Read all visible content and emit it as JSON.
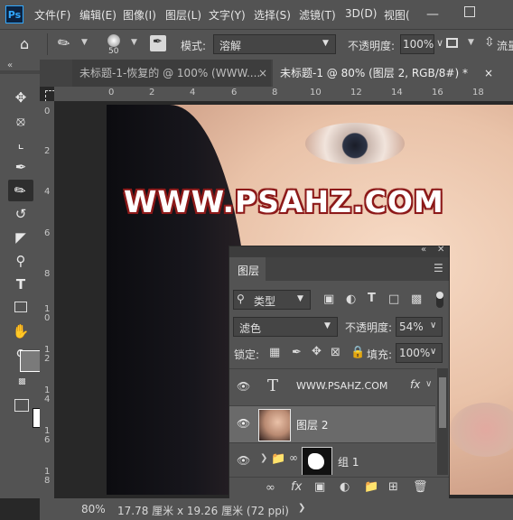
{
  "app": {
    "logo_text": "Ps"
  },
  "menubar": {
    "items": [
      "文件(F)",
      "编辑(E)",
      "图像(I)",
      "图层(L)",
      "文字(Y)",
      "选择(S)",
      "滤镜(T)",
      "3D(D)",
      "视图("
    ]
  },
  "options": {
    "brush_size": "50",
    "mode_label": "模式:",
    "mode_value": "溶解",
    "opacity_label": "不透明度:",
    "opacity_value": "100%",
    "flow_label": "流量"
  },
  "tabs": [
    {
      "label": "未标题-1-恢复的 @ 100% (WWW....",
      "close": "×"
    },
    {
      "label": "未标题-1 @ 80% (图层 2, RGB/8#) *",
      "close": "×"
    }
  ],
  "ruler": {
    "top": [
      "0",
      "2",
      "4",
      "6",
      "8",
      "10",
      "12",
      "14",
      "16",
      "18"
    ],
    "left": [
      "0",
      "2",
      "4",
      "6",
      "8",
      "1\n0",
      "1\n2",
      "1\n4",
      "1\n6",
      "1\n8"
    ]
  },
  "canvas": {
    "watermark": "WWW.PSAHZ.COM"
  },
  "status": {
    "zoom": "80%",
    "doc_size": "17.78 厘米 x 19.26 厘米 (72 ppi)"
  },
  "layers_panel": {
    "title": "图层",
    "filter_kind": "类型",
    "blend_mode": "滤色",
    "opacity_label": "不透明度:",
    "opacity_value": "54%",
    "lock_label": "锁定:",
    "fill_label": "填充:",
    "fill_value": "100%",
    "layers": [
      {
        "name": "WWW.PSAHZ.COM",
        "type": "text",
        "fx": "fx"
      },
      {
        "name": "图层 2",
        "type": "pixel"
      },
      {
        "name": "组 1",
        "type": "group"
      }
    ]
  },
  "colors": {
    "foreground": "#7a7a7a",
    "background": "#ffffff",
    "accent": "#31a8ff"
  }
}
